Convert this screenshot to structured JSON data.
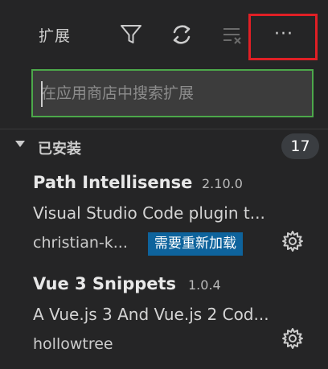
{
  "header": {
    "title": "扩展",
    "icons": [
      "filter-icon",
      "refresh-icon",
      "clear-icon",
      "more-actions-icon"
    ],
    "more_label": "···"
  },
  "search": {
    "placeholder": "在应用商店中搜索扩展",
    "value": ""
  },
  "installed": {
    "title": "已安装",
    "count": "17",
    "extensions": [
      {
        "name": "Path Intellisense",
        "version": "2.10.0",
        "description": "Visual Studio Code plugin t...",
        "author": "christian-k...",
        "action": "需要重新加载"
      },
      {
        "name": "Vue 3 Snippets",
        "version": "1.0.4",
        "description": "A Vue.js 3 And Vue.js 2 Cod...",
        "author": "hollowtree"
      }
    ]
  },
  "colors": {
    "background": "#252526",
    "accent": "#0e639c",
    "focus_border": "#4ca84a",
    "highlight_box": "#e01f25"
  }
}
